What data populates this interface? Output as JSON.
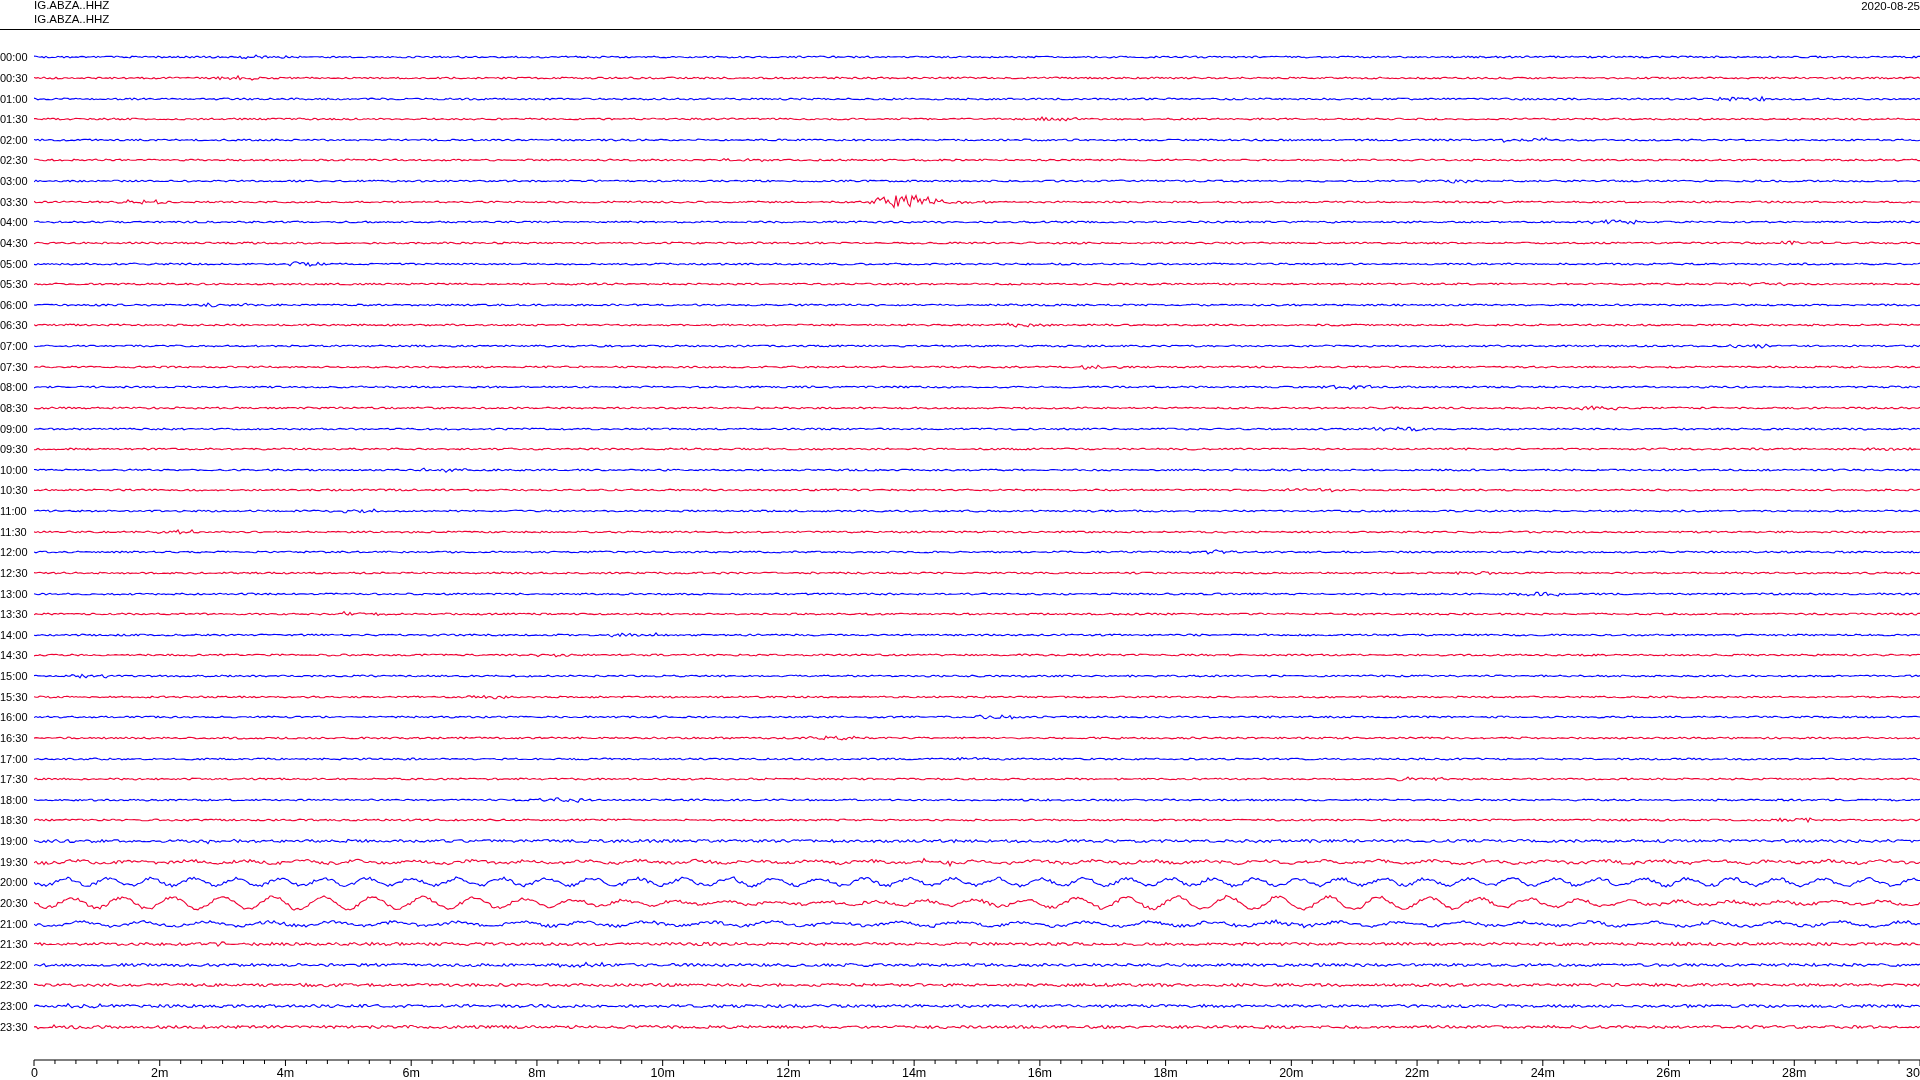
{
  "header": {
    "channel_lines": [
      "IG.ABZA..HHZ",
      "IG.ABZA..HHZ"
    ],
    "date": "2020-08-25"
  },
  "traces": [
    {
      "time": "00:00",
      "color": "#0000ff"
    },
    {
      "time": "00:30",
      "color": "#ee0033"
    },
    {
      "time": "01:00",
      "color": "#0000ff"
    },
    {
      "time": "01:30",
      "color": "#ee0033"
    },
    {
      "time": "02:00",
      "color": "#0000ff"
    },
    {
      "time": "02:30",
      "color": "#ee0033"
    },
    {
      "time": "03:00",
      "color": "#0000ff"
    },
    {
      "time": "03:30",
      "color": "#ee0033"
    },
    {
      "time": "04:00",
      "color": "#0000ff"
    },
    {
      "time": "04:30",
      "color": "#ee0033"
    },
    {
      "time": "05:00",
      "color": "#0000ff"
    },
    {
      "time": "05:30",
      "color": "#ee0033"
    },
    {
      "time": "06:00",
      "color": "#0000ff"
    },
    {
      "time": "06:30",
      "color": "#ee0033"
    },
    {
      "time": "07:00",
      "color": "#0000ff"
    },
    {
      "time": "07:30",
      "color": "#ee0033"
    },
    {
      "time": "08:00",
      "color": "#0000ff"
    },
    {
      "time": "08:30",
      "color": "#ee0033"
    },
    {
      "time": "09:00",
      "color": "#0000ff"
    },
    {
      "time": "09:30",
      "color": "#ee0033"
    },
    {
      "time": "10:00",
      "color": "#0000ff"
    },
    {
      "time": "10:30",
      "color": "#ee0033"
    },
    {
      "time": "11:00",
      "color": "#0000ff"
    },
    {
      "time": "11:30",
      "color": "#ee0033"
    },
    {
      "time": "12:00",
      "color": "#0000ff"
    },
    {
      "time": "12:30",
      "color": "#ee0033"
    },
    {
      "time": "13:00",
      "color": "#0000ff"
    },
    {
      "time": "13:30",
      "color": "#ee0033"
    },
    {
      "time": "14:00",
      "color": "#0000ff"
    },
    {
      "time": "14:30",
      "color": "#ee0033"
    },
    {
      "time": "15:00",
      "color": "#0000ff"
    },
    {
      "time": "15:30",
      "color": "#ee0033"
    },
    {
      "time": "16:00",
      "color": "#0000ff"
    },
    {
      "time": "16:30",
      "color": "#ee0033"
    },
    {
      "time": "17:00",
      "color": "#0000ff"
    },
    {
      "time": "17:30",
      "color": "#ee0033"
    },
    {
      "time": "18:00",
      "color": "#0000ff"
    },
    {
      "time": "18:30",
      "color": "#ee0033"
    },
    {
      "time": "19:00",
      "color": "#0000ff"
    },
    {
      "time": "19:30",
      "color": "#ee0033"
    },
    {
      "time": "20:00",
      "color": "#0000ff"
    },
    {
      "time": "20:30",
      "color": "#ee0033"
    },
    {
      "time": "21:00",
      "color": "#0000ff"
    },
    {
      "time": "21:30",
      "color": "#ee0033"
    },
    {
      "time": "22:00",
      "color": "#0000ff"
    },
    {
      "time": "22:30",
      "color": "#ee0033"
    },
    {
      "time": "23:00",
      "color": "#0000ff"
    },
    {
      "time": "23:30",
      "color": "#ee0033"
    }
  ],
  "x_axis": {
    "labels": [
      "0",
      "2m",
      "4m",
      "6m",
      "8m",
      "10m",
      "12m",
      "14m",
      "16m",
      "18m",
      "20m",
      "22m",
      "24m",
      "26m",
      "28m",
      "30"
    ]
  }
}
